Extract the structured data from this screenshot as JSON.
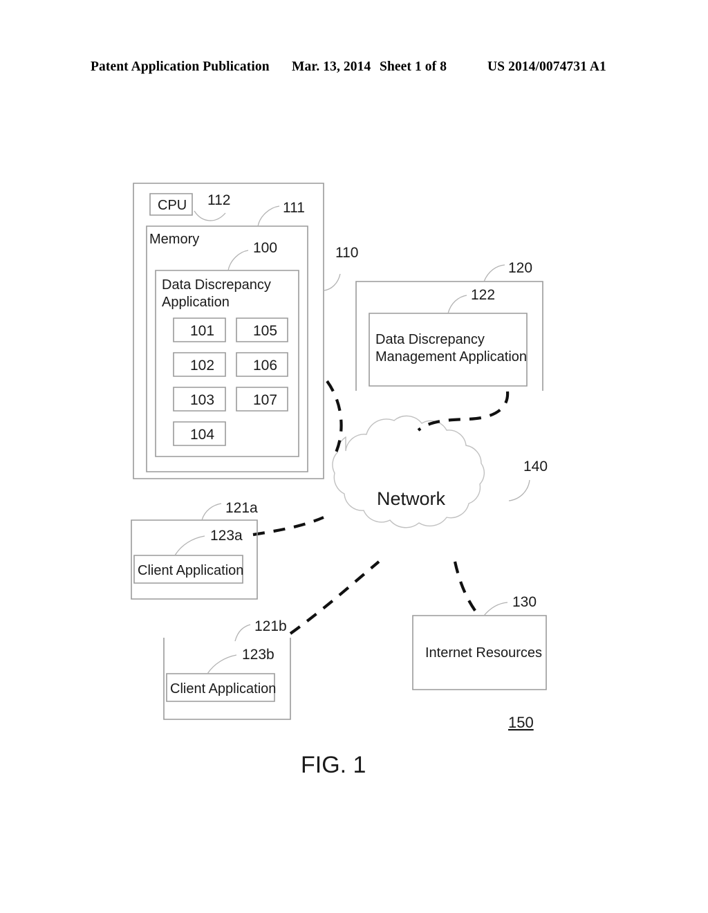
{
  "header": {
    "publication": "Patent Application Publication",
    "date": "Mar. 13, 2014",
    "sheet": "Sheet 1 of 8",
    "patent_number": "US 2014/0074731 A1"
  },
  "figure": {
    "caption": "FIG. 1",
    "system_ref": "150",
    "nodes": {
      "computing_device": {
        "ref": "110",
        "cpu_label": "CPU",
        "cpu_ref": "112",
        "memory_label": "Memory",
        "memory_ref": "111",
        "application": {
          "ref": "100",
          "label_line1": "Data Discrepancy",
          "label_line2": "Application",
          "modules_left": [
            "101",
            "102",
            "103",
            "104"
          ],
          "modules_right": [
            "105",
            "106",
            "107"
          ]
        }
      },
      "server": {
        "ref": "120",
        "application": {
          "ref": "122",
          "label_line1": "Data Discrepancy",
          "label_line2": "Management Application"
        }
      },
      "network": {
        "ref": "140",
        "label": "Network"
      },
      "internet_resources": {
        "ref": "130",
        "label": "Internet Resources"
      },
      "client_a": {
        "ref": "121a",
        "app_ref": "123a",
        "app_label": "Client Application"
      },
      "client_b": {
        "ref": "121b",
        "app_ref": "123b",
        "app_label": "Client Application"
      }
    }
  }
}
